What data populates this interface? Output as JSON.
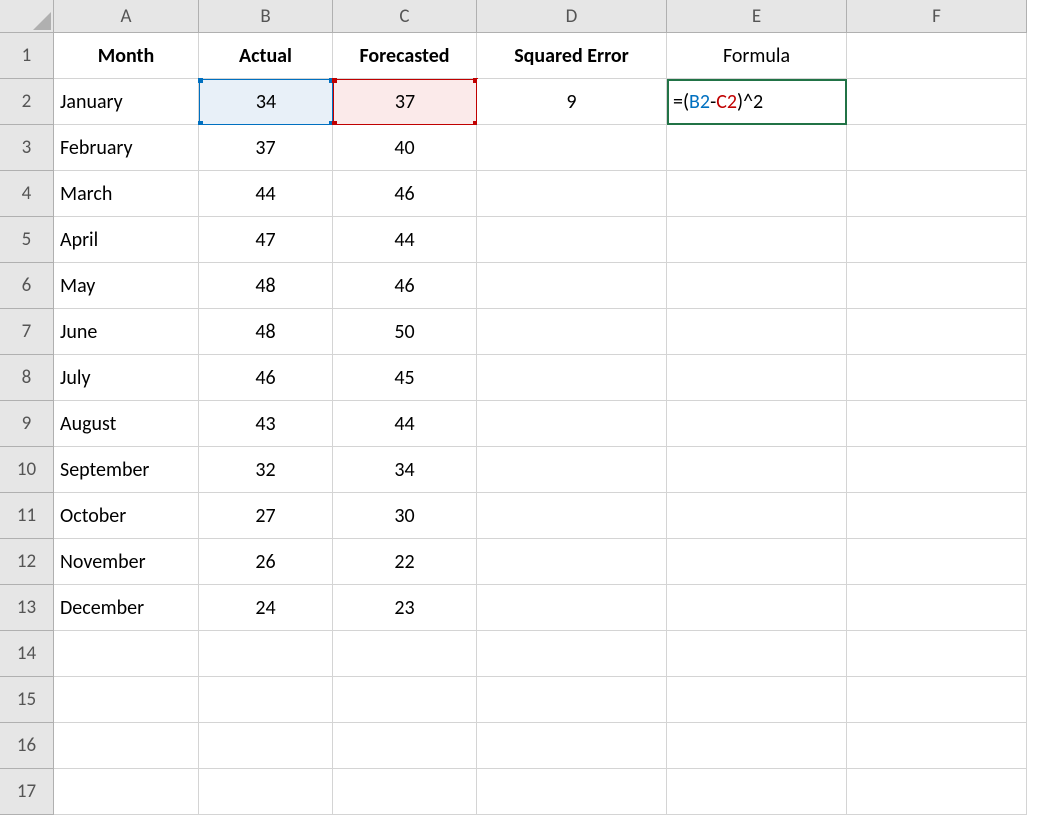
{
  "columns": [
    "A",
    "B",
    "C",
    "D",
    "E",
    "F"
  ],
  "rowNumbers": [
    "1",
    "2",
    "3",
    "4",
    "5",
    "6",
    "7",
    "8",
    "9",
    "10",
    "11",
    "12",
    "13",
    "14",
    "15",
    "16",
    "17"
  ],
  "headers": {
    "A": "Month",
    "B": "Actual",
    "C": "Forecasted",
    "D": "Squared Error",
    "E": "Formula"
  },
  "rows": [
    {
      "month": "January",
      "actual": "34",
      "forecasted": "37",
      "sqerr": "9"
    },
    {
      "month": "February",
      "actual": "37",
      "forecasted": "40",
      "sqerr": ""
    },
    {
      "month": "March",
      "actual": "44",
      "forecasted": "46",
      "sqerr": ""
    },
    {
      "month": "April",
      "actual": "47",
      "forecasted": "44",
      "sqerr": ""
    },
    {
      "month": "May",
      "actual": "48",
      "forecasted": "46",
      "sqerr": ""
    },
    {
      "month": "June",
      "actual": "48",
      "forecasted": "50",
      "sqerr": ""
    },
    {
      "month": "July",
      "actual": "46",
      "forecasted": "45",
      "sqerr": ""
    },
    {
      "month": "August",
      "actual": "43",
      "forecasted": "44",
      "sqerr": ""
    },
    {
      "month": "September",
      "actual": "32",
      "forecasted": "34",
      "sqerr": ""
    },
    {
      "month": "October",
      "actual": "27",
      "forecasted": "30",
      "sqerr": ""
    },
    {
      "month": "November",
      "actual": "26",
      "forecasted": "22",
      "sqerr": ""
    },
    {
      "month": "December",
      "actual": "24",
      "forecasted": "23",
      "sqerr": ""
    }
  ],
  "formula": {
    "eq": "=",
    "open": "(",
    "ref1": "B2",
    "minus": "-",
    "ref2": "C2",
    "close": ")",
    "caret": "^",
    "two": "2"
  }
}
